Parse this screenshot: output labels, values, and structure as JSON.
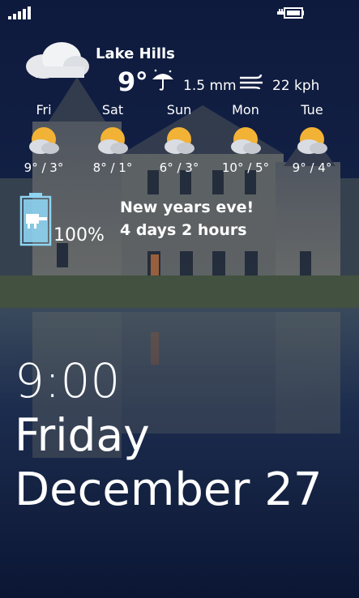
{
  "weather": {
    "location": "Lake Hills",
    "temperature": "9°",
    "precipitation": "1.5 mm",
    "wind": "22 kph",
    "forecast": [
      {
        "day": "Fri",
        "range": "9° / 3°",
        "icon": "partly-cloudy-icon"
      },
      {
        "day": "Sat",
        "range": "8° / 1°",
        "icon": "partly-cloudy-icon"
      },
      {
        "day": "Sun",
        "range": "6° / 3°",
        "icon": "partly-cloudy-icon"
      },
      {
        "day": "Mon",
        "range": "10° / 5°",
        "icon": "partly-cloudy-icon"
      },
      {
        "day": "Tue",
        "range": "9° / 4°",
        "icon": "partly-cloudy-icon"
      }
    ]
  },
  "battery": {
    "percent": "100%"
  },
  "event": {
    "title": "New years eve!",
    "countdown": "4 days 2 hours"
  },
  "clock": {
    "time": "9:00",
    "weekday": "Friday",
    "date": "December 27"
  },
  "icons": {
    "status": [
      "signal-strength-icon",
      "battery-charging-icon"
    ],
    "weather": [
      "cloud-icon",
      "umbrella-rain-icon",
      "wind-icon"
    ]
  },
  "colors": {
    "sky": "#13224a",
    "water": "#0d1a3c",
    "accent_battery": "#8ed4f2"
  }
}
